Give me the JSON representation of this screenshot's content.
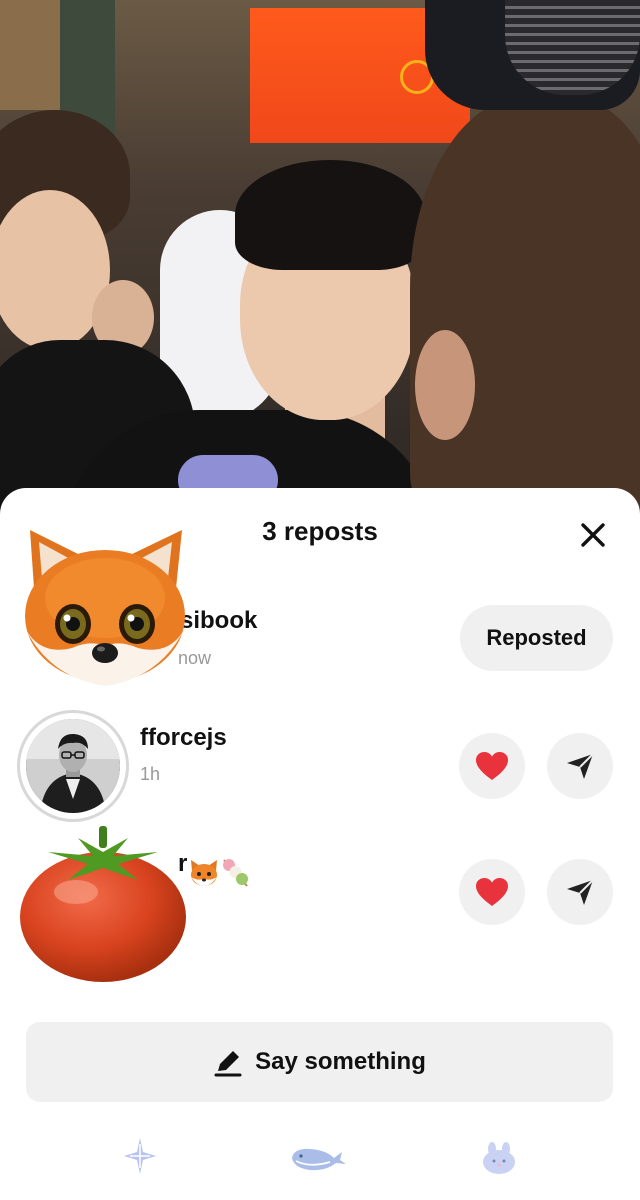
{
  "sheet": {
    "title": "3 reposts",
    "close_icon": "close-icon"
  },
  "reposts": [
    {
      "name": "sibook",
      "time": "now",
      "avatar": "fox-memoji",
      "action_label": "Reposted"
    },
    {
      "name": "fforcejs",
      "time": "1h",
      "avatar": "profile-photo",
      "actions": [
        "heart-icon",
        "send-icon"
      ]
    },
    {
      "name": "r",
      "avatar": "tomato-emoji",
      "name_emojis": [
        "fox-emoji",
        "dango-emoji"
      ],
      "actions": [
        "heart-icon",
        "send-icon"
      ]
    }
  ],
  "compose": {
    "label": "Say something",
    "icon": "pen-icon"
  },
  "bottom_nav": [
    "sparkle-icon",
    "whale-icon",
    "bunny-icon"
  ],
  "colors": {
    "heart": "#e8323c",
    "button_bg": "#f0f0f0",
    "text": "#111111",
    "subtext": "#999999"
  }
}
